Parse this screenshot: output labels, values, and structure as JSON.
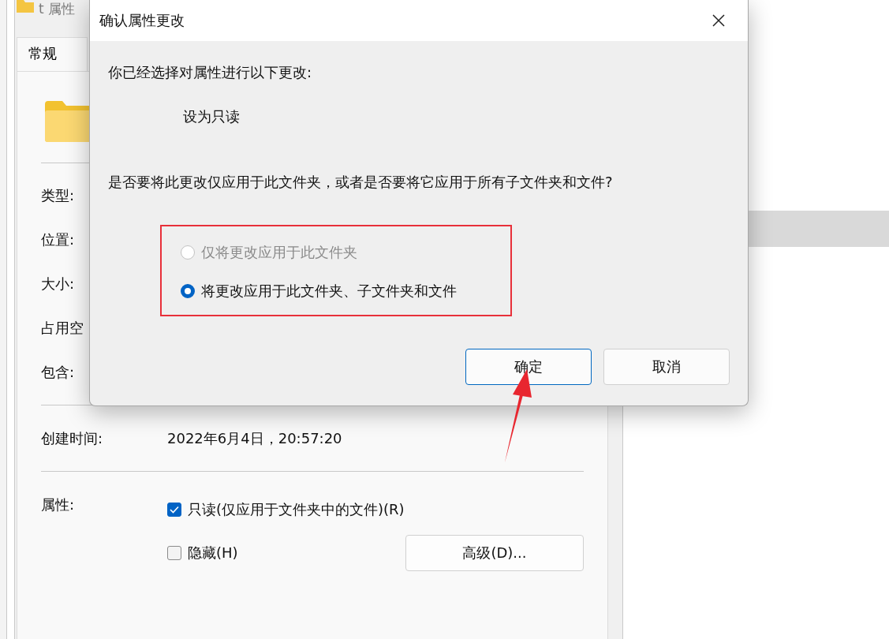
{
  "properties_window": {
    "title": "t 属性",
    "tabs": [
      {
        "label": "常规",
        "selected": true
      }
    ],
    "fields": [
      {
        "label": "类型:"
      },
      {
        "label": "位置:"
      },
      {
        "label": "大小:"
      },
      {
        "label": "占用空"
      },
      {
        "label": "包含:"
      }
    ],
    "created": {
      "label": "创建时间:",
      "value": "2022年6月4日，20:57:20"
    },
    "attributes": {
      "label": "属性:",
      "checkboxes": [
        {
          "label": "只读(仅应用于文件夹中的文件)(R)",
          "checked": true
        },
        {
          "label": "隐藏(H)",
          "checked": false
        }
      ],
      "advanced_button": "高级(D)..."
    }
  },
  "dialog": {
    "title": "确认属性更改",
    "intro": "你已经选择对属性进行以下更改:",
    "change": "设为只读",
    "question": "是否要将此更改仅应用于此文件夹，或者是否要将它应用于所有子文件夹和文件?",
    "options": [
      {
        "label": "仅将更改应用于此文件夹",
        "selected": false,
        "disabled": true
      },
      {
        "label": "将更改应用于此文件夹、子文件夹和文件",
        "selected": true,
        "disabled": false
      }
    ],
    "buttons": [
      {
        "label": "确定",
        "default": true
      },
      {
        "label": "取消",
        "default": false
      }
    ]
  }
}
